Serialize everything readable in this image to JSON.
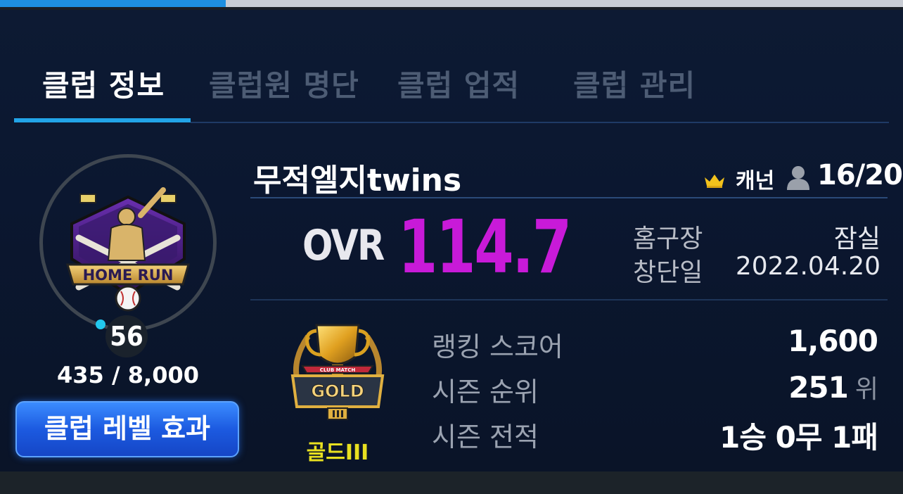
{
  "top_progress": {
    "fraction": 0.25,
    "fill_color": "#1e8fe0"
  },
  "tabs": [
    {
      "label": "클럽 정보",
      "active": true
    },
    {
      "label": "클럽원 명단",
      "active": false
    },
    {
      "label": "클럽 업적",
      "active": false
    },
    {
      "label": "클럽 관리",
      "active": false
    }
  ],
  "club": {
    "emblem_text": "HOME RUN",
    "level": "56",
    "exp": "435 / 8,000",
    "level_effect_button": "클럽 레벨 효과",
    "name": "무적엘지twins",
    "leader": "캐넌",
    "members": "16/20",
    "ovr_label": "OVR",
    "ovr_value": "114.7",
    "home_label": "홈구장",
    "home_value": "잠실",
    "founded_label": "창단일",
    "founded_value": "2022.04.20"
  },
  "ranking": {
    "emblem_top": "CLUB MATCH",
    "emblem_text": "GOLD",
    "tier_label": "골드III",
    "score_label": "랭킹 스코어",
    "score_value": "1,600",
    "rank_label": "시즌 순위",
    "rank_value": "251",
    "rank_unit": "위",
    "record_label": "시즌 전적",
    "record_value": "1승 0무 1패"
  },
  "colors": {
    "accent": "#22a4e8",
    "ovr": "#c81ad8",
    "tier": "#e8e020",
    "button": "#1c5ae0"
  },
  "icons": [
    "crown-icon",
    "person-icon",
    "home-run-emblem",
    "gold-trophy-emblem"
  ]
}
